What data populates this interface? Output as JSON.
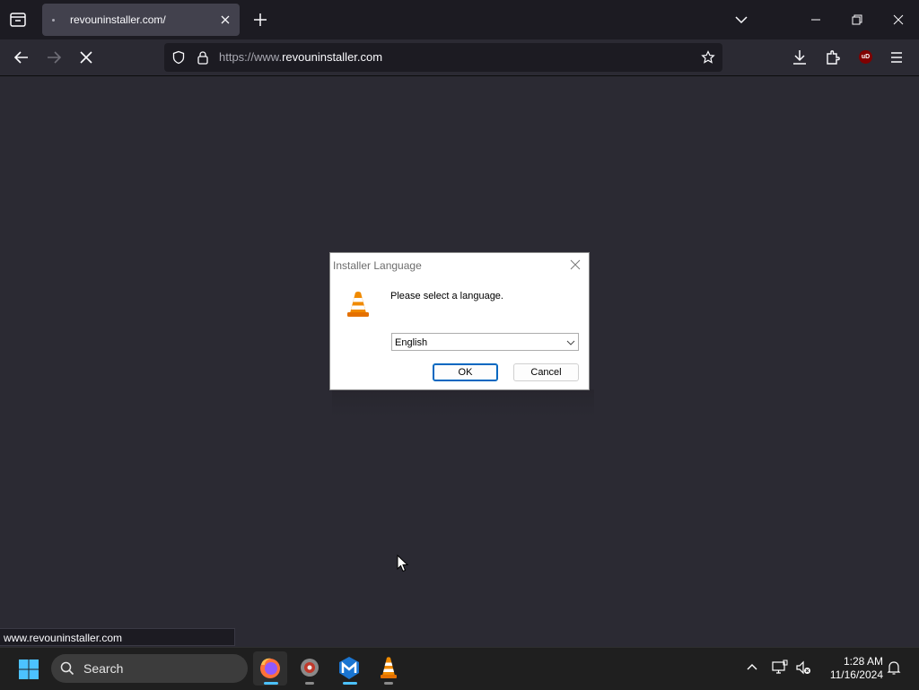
{
  "browser": {
    "tab": {
      "title": "revouninstaller.com/"
    },
    "url": {
      "prefix": "https://www.",
      "domain": "revouninstaller.com"
    },
    "extension_badge": "uD",
    "status_url": "www.revouninstaller.com"
  },
  "dialog": {
    "title": "Installer Language",
    "prompt": "Please select a language.",
    "language_select": {
      "selected": "English"
    },
    "ok_label": "OK",
    "cancel_label": "Cancel"
  },
  "taskbar": {
    "search_placeholder": "Search",
    "apps": [
      "firefox-icon",
      "revo-uninstaller-icon",
      "malwarebytes-icon",
      "vlc-icon"
    ],
    "clock": {
      "time": "1:28 AM",
      "date": "11/16/2024"
    }
  },
  "colors": {
    "browser_bg": "#2b2a33",
    "tabstrip_bg": "#1c1b22",
    "taskbar_bg": "#1f1f1f",
    "accent": "#0067c0"
  }
}
